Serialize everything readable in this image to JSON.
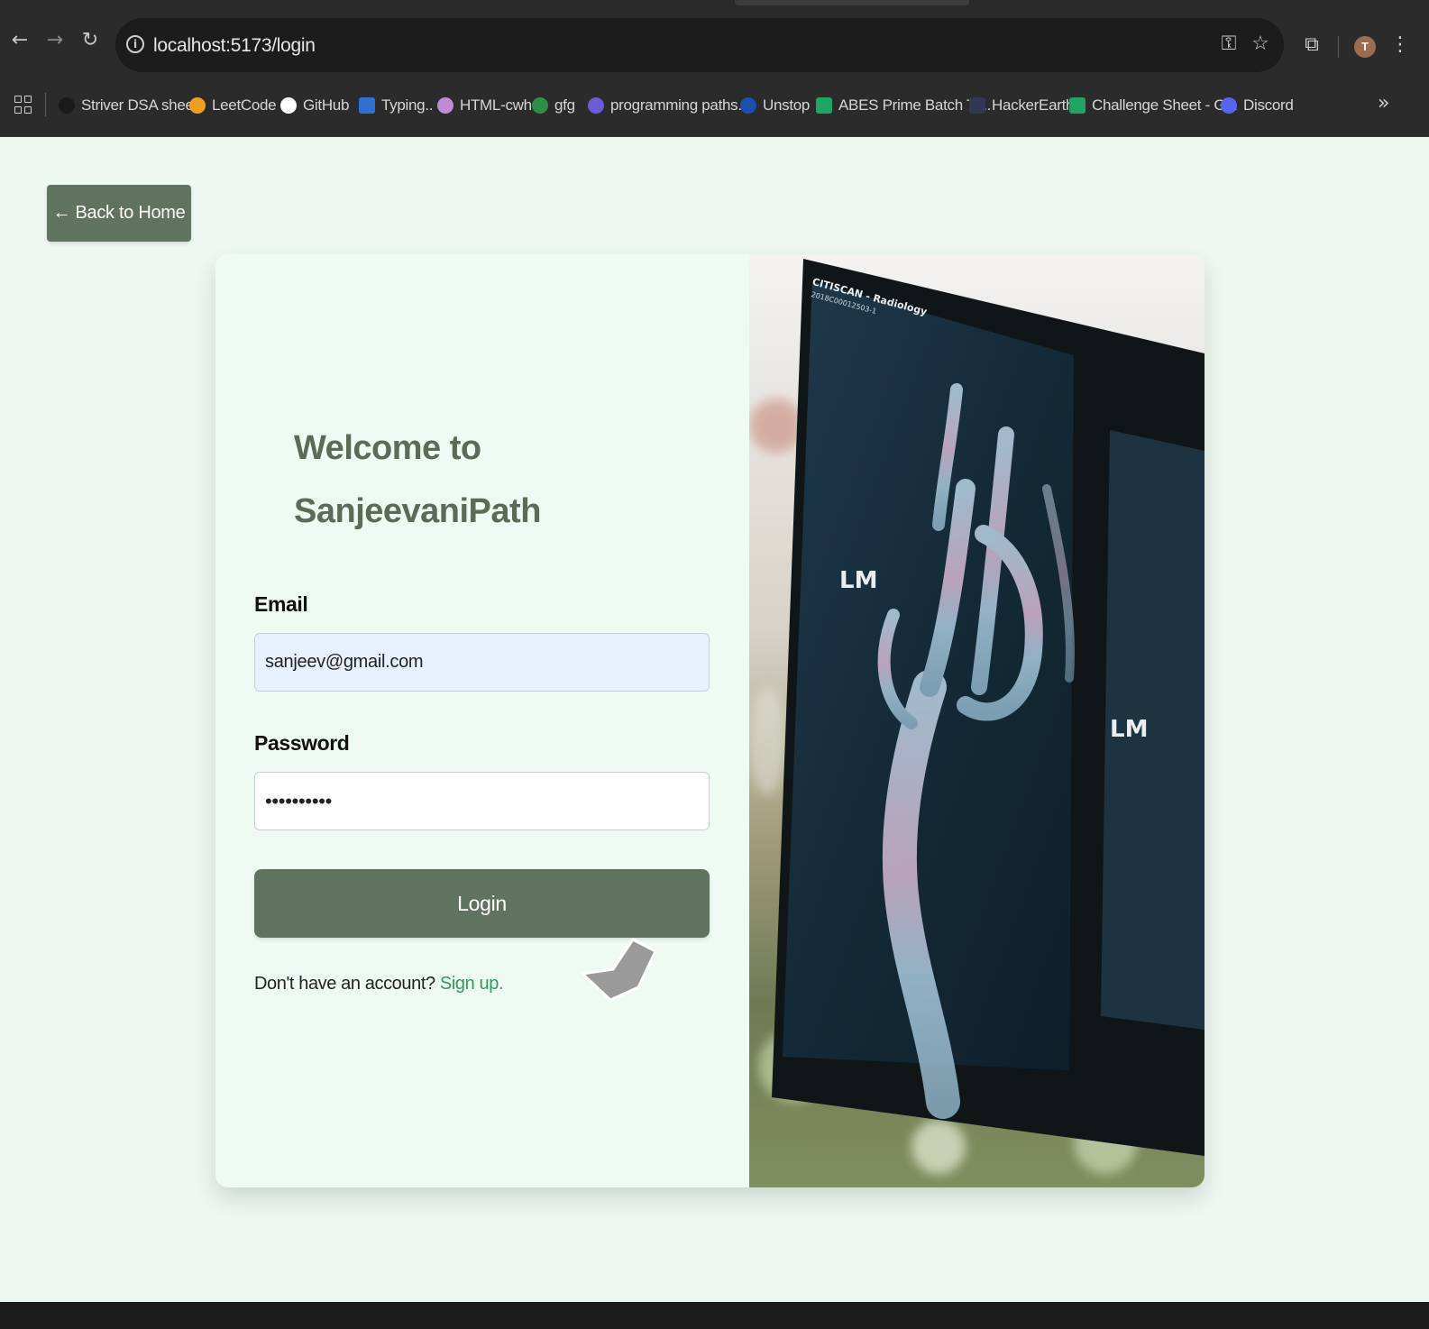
{
  "browser": {
    "url": "localhost:5173/login",
    "avatar_letter": "T",
    "bookmarks": [
      {
        "label": "Striver DSA sheet",
        "icon": "striver-icon",
        "color": "#1a1a1a"
      },
      {
        "label": "LeetCode",
        "icon": "leetcode-icon",
        "color": "#f0a020"
      },
      {
        "label": "GitHub",
        "icon": "github-icon",
        "color": "#ffffff"
      },
      {
        "label": "Typing..",
        "icon": "typing-icon",
        "color": "#2f6fd6"
      },
      {
        "label": "HTML-cwh",
        "icon": "cwh-icon",
        "color": "#c08ad8"
      },
      {
        "label": "gfg",
        "icon": "gfg-icon",
        "color": "#2f8d46"
      },
      {
        "label": "programming paths...",
        "icon": "programming-paths-icon",
        "color": "#6b5bd6"
      },
      {
        "label": "Unstop",
        "icon": "unstop-icon",
        "color": "#1c4fb0"
      },
      {
        "label": "ABES Prime Batch Tr...",
        "icon": "sheets-icon",
        "color": "#1fa463"
      },
      {
        "label": "HackerEarth",
        "icon": "hackerearth-icon",
        "color": "#323754"
      },
      {
        "label": "Challenge Sheet - G...",
        "icon": "sheets-icon",
        "color": "#1fa463"
      },
      {
        "label": "Discord",
        "icon": "discord-icon",
        "color": "#5865f2"
      }
    ]
  },
  "page": {
    "back_label": "← Back to Home",
    "welcome_line1": "Welcome to",
    "welcome_line2": "SanjeevaniPath",
    "email_label": "Email",
    "email_value": "sanjeev@gmail.com",
    "password_label": "Password",
    "password_value": "••••••••••",
    "login_label": "Login",
    "signup_prompt": "Don't have an account?",
    "signup_link": "Sign up."
  },
  "image": {
    "film_header": "CITISCAN - Radiology",
    "film_id": "2018C00012503-1",
    "film_marker": "LM"
  },
  "colors": {
    "accent": "#5f7360",
    "heading": "#5a6b57",
    "link": "#2f9a62",
    "page_bg": "#eef8f1"
  }
}
